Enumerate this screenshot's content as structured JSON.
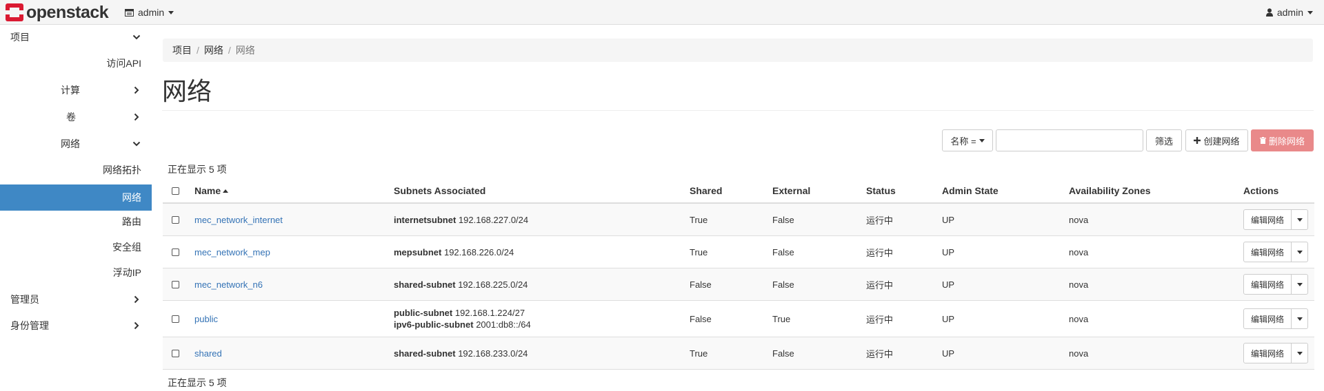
{
  "brand": {
    "name": "openstack"
  },
  "topbar": {
    "project": "admin",
    "user": "admin"
  },
  "sidebar": {
    "project": "项目",
    "api_access": "访问API",
    "compute": "计算",
    "volumes": "卷",
    "network": "网络",
    "network_topology": "网络拓扑",
    "networks": "网络",
    "routers": "路由",
    "security_groups": "安全组",
    "floating_ips": "浮动IP",
    "admin": "管理员",
    "identity": "身份管理"
  },
  "breadcrumb": [
    "项目",
    "网络",
    "网络"
  ],
  "page_title": "网络",
  "toolbar": {
    "filter_field": "名称 =",
    "filter_value": "",
    "filter_button": "筛选",
    "create_button": "创建网络",
    "delete_button": "删除网络"
  },
  "count_text": "正在显示 5 项",
  "table": {
    "headers": {
      "name": "Name",
      "subnets": "Subnets Associated",
      "shared": "Shared",
      "external": "External",
      "status": "Status",
      "admin_state": "Admin State",
      "zones": "Availability Zones",
      "actions": "Actions"
    },
    "rows": [
      {
        "name": "mec_network_internet",
        "subnets": [
          {
            "name": "internetsubnet",
            "cidr": "192.168.227.0/24"
          }
        ],
        "shared": "True",
        "external": "False",
        "status": "运行中",
        "admin_state": "UP",
        "zones": "nova",
        "action": "编辑网络"
      },
      {
        "name": "mec_network_mep",
        "subnets": [
          {
            "name": "mepsubnet",
            "cidr": "192.168.226.0/24"
          }
        ],
        "shared": "True",
        "external": "False",
        "status": "运行中",
        "admin_state": "UP",
        "zones": "nova",
        "action": "编辑网络"
      },
      {
        "name": "mec_network_n6",
        "subnets": [
          {
            "name": "shared-subnet",
            "cidr": "192.168.225.0/24"
          }
        ],
        "shared": "False",
        "external": "False",
        "status": "运行中",
        "admin_state": "UP",
        "zones": "nova",
        "action": "编辑网络"
      },
      {
        "name": "public",
        "subnets": [
          {
            "name": "public-subnet",
            "cidr": "192.168.1.224/27"
          },
          {
            "name": "ipv6-public-subnet",
            "cidr": "2001:db8::/64"
          }
        ],
        "shared": "False",
        "external": "True",
        "status": "运行中",
        "admin_state": "UP",
        "zones": "nova",
        "action": "编辑网络"
      },
      {
        "name": "shared",
        "subnets": [
          {
            "name": "shared-subnet",
            "cidr": "192.168.233.0/24"
          }
        ],
        "shared": "True",
        "external": "False",
        "status": "运行中",
        "admin_state": "UP",
        "zones": "nova",
        "action": "编辑网络"
      }
    ]
  },
  "colors": {
    "accent": "#3f88c5",
    "link": "#3372b5",
    "danger": "#e9898a",
    "brand_red": "#da1a32"
  }
}
